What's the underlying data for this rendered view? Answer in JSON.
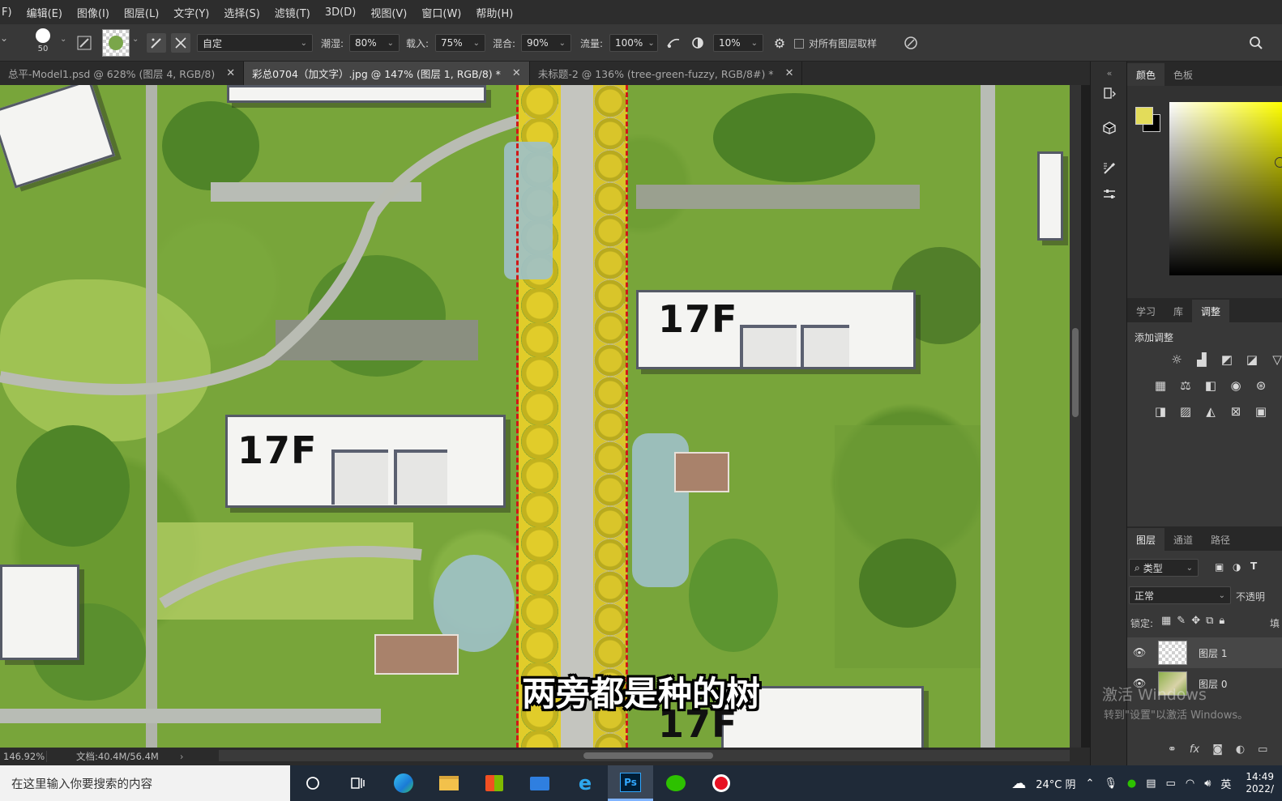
{
  "menu": [
    "F)",
    "编辑(E)",
    "图像(I)",
    "图层(L)",
    "文字(Y)",
    "选择(S)",
    "滤镜(T)",
    "3D(D)",
    "视图(V)",
    "窗口(W)",
    "帮助(H)"
  ],
  "options": {
    "brush_size": "50",
    "preset": "自定",
    "wet_label": "潮湿:",
    "wet": "80%",
    "load_label": "载入:",
    "load": "75%",
    "mix_label": "混合:",
    "mix": "90%",
    "flow_label": "流量:",
    "flow": "100%",
    "smoothing": "10%",
    "sample_all_label": "对所有图层取样"
  },
  "tabs": [
    {
      "label": "总平-Model1.psd @ 628% (图层 4, RGB/8)",
      "close": "✕"
    },
    {
      "label": "彩总0704（加文字）.jpg @ 147% (图层 1, RGB/8) *",
      "close": "✕"
    },
    {
      "label": "未标题-2 @ 136% (tree-green-fuzzy, RGB/8#) *",
      "close": "✕"
    }
  ],
  "canvas": {
    "labels": [
      "17F",
      "17F",
      "17F"
    ],
    "subtitle": "两旁都是种的树"
  },
  "status": {
    "zoom": "146.92%",
    "doc": "文档:40.4M/56.4M",
    "arrow": "›"
  },
  "color_panel": {
    "tabs": [
      "颜色",
      "色板"
    ],
    "fg_color": "#e3dc5a",
    "bg_color": "#000000"
  },
  "adjust_panel": {
    "tabs": [
      "学习",
      "库",
      "调整"
    ],
    "title": "添加调整"
  },
  "layers_panel": {
    "tabs": [
      "图层",
      "通道",
      "路径"
    ],
    "filter_kind": "类型",
    "blend_mode": "正常",
    "opacity_label": "不透明",
    "lock_label": "锁定:",
    "fill_label": "填",
    "layers": [
      {
        "name": "图层 1",
        "selected": true
      },
      {
        "name": "图层 0",
        "selected": false
      }
    ]
  },
  "watermark": {
    "line1": "激活 Windows",
    "line2": "转到\"设置\"以激活 Windows。"
  },
  "taskbar": {
    "search_placeholder": "在这里输入你要搜索的内容",
    "weather": "24°C 阴",
    "ime": "英",
    "time": "14:49",
    "date": "2022/"
  }
}
